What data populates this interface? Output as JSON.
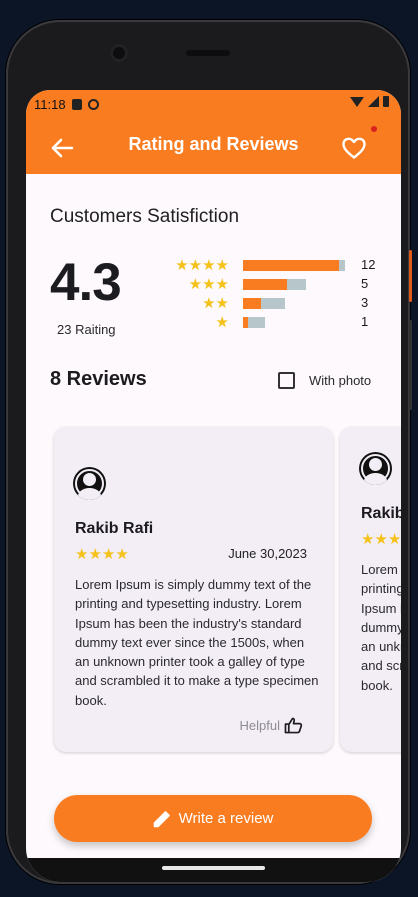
{
  "status": {
    "time": "11:18"
  },
  "appbar": {
    "title": "Rating and Reviews"
  },
  "summary": {
    "title": "Customers Satisfiction",
    "score": "4.3",
    "count_label": "23 Raiting",
    "breakdown": [
      {
        "stars": "★★★★",
        "count": "12",
        "fill": 0.91,
        "track": 0.97
      },
      {
        "stars": "★★★",
        "count": "5",
        "fill": 0.42,
        "track": 0.6
      },
      {
        "stars": "★★",
        "count": "3",
        "fill": 0.17,
        "track": 0.4
      },
      {
        "stars": "★",
        "count": "1",
        "fill": 0.05,
        "track": 0.21
      }
    ]
  },
  "reviews": {
    "title": "8 Reviews",
    "filter_label": "With photo",
    "items": [
      {
        "name": "Rakib Rafi",
        "stars": "★★★★",
        "date": "June 30,2023",
        "text": "Lorem Ipsum is simply dummy text of the printing and typesetting industry. Lorem Ipsum has been the industry's standard dummy text ever since the 1500s, when an unknown printer took a galley of type and scrambled it to make a type specimen book.",
        "helpful_label": "Helpful"
      },
      {
        "name": "Rakib Rafi",
        "stars": "★★★★",
        "date": "",
        "text": "Lorem Ipsum is simply dummy text of the printing and typesetting industry. Lorem Ipsum has been the industry's standard dummy text ever since the 1500s, when an unknown printer took a galley of type and scrambled it to make a type specimen book.",
        "helpful_label": ""
      }
    ]
  },
  "actions": {
    "write_review_label": "Write a review"
  },
  "colors": {
    "accent": "#fa7c21",
    "star": "#f4c21b",
    "track": "#b7c6cb"
  }
}
